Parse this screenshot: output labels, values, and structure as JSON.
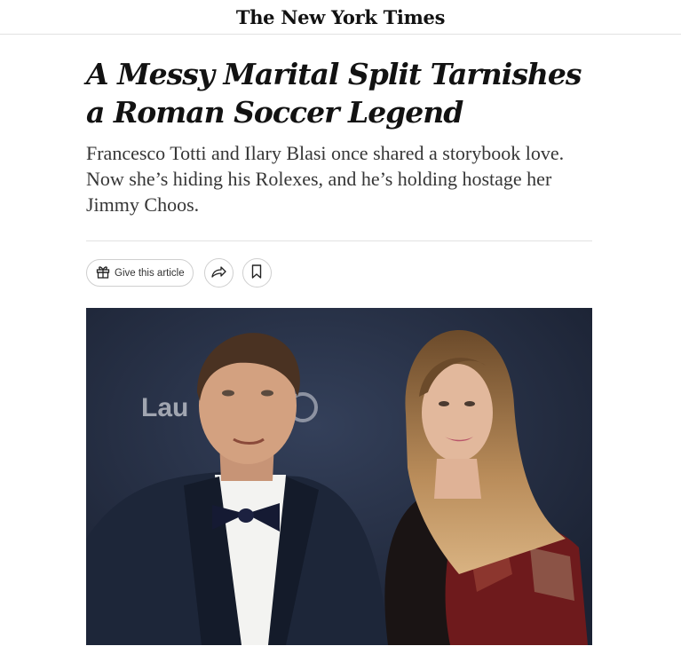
{
  "masthead": {
    "logo_text": "The New York Times"
  },
  "article": {
    "headline": "A Messy Marital Split Tarnishes a Roman Soccer Legend",
    "summary": "Francesco Totti and Ilary Blasi once shared a storybook love. Now she’s hiding his Rolexes, and he’s holding hostage her Jimmy Choos."
  },
  "actions": {
    "gift_label": "Give this article",
    "gift_icon": "gift-icon",
    "share_icon": "share-arrow-icon",
    "save_icon": "bookmark-icon"
  },
  "photo": {
    "backdrop_logo_text": "Lau",
    "colors": {
      "backdrop": "#262f43",
      "suit": "#1d2639",
      "dress": "#6e1a1c"
    }
  }
}
